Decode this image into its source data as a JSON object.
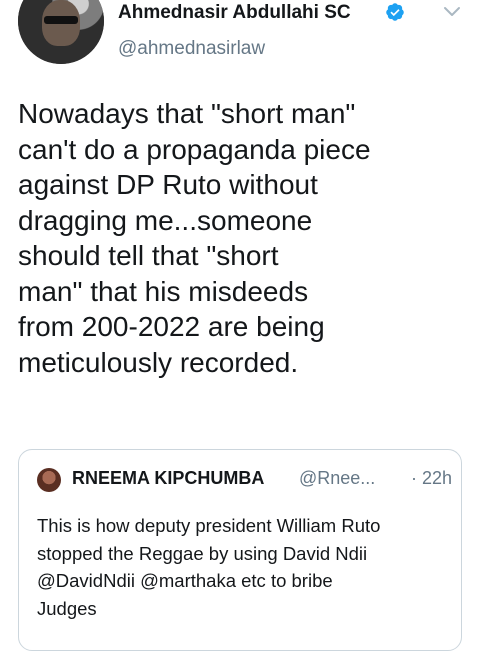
{
  "tweet": {
    "author_name": "Ahmednasir Abdullahi SC",
    "author_handle": "@ahmednasirlaw",
    "avatar_icon": "profile-photo",
    "verified_icon": "verified-badge-icon",
    "menu_icon": "chevron-down-icon",
    "text_lines": [
      "Nowadays that \"short man\"",
      "can't do a propaganda piece",
      "against DP Ruto without",
      "dragging me...someone",
      "should tell that \"short",
      "man\" that his misdeeds",
      "from 200-2022 are being",
      "meticulously recorded."
    ]
  },
  "quoted_tweet": {
    "author_name": "RNEEMA KIPCHUMBA",
    "author_handle": "@Rnee...",
    "time": "· 22h",
    "text_lines": [
      "This is how deputy president William Ruto",
      "stopped the Reggae by using David Ndii",
      "@DavidNdii @marthaka etc to bribe",
      "Judges"
    ]
  },
  "colors": {
    "verified_blue": "#1da1f2",
    "secondary_text": "#657786",
    "border": "#ccd6dd"
  }
}
